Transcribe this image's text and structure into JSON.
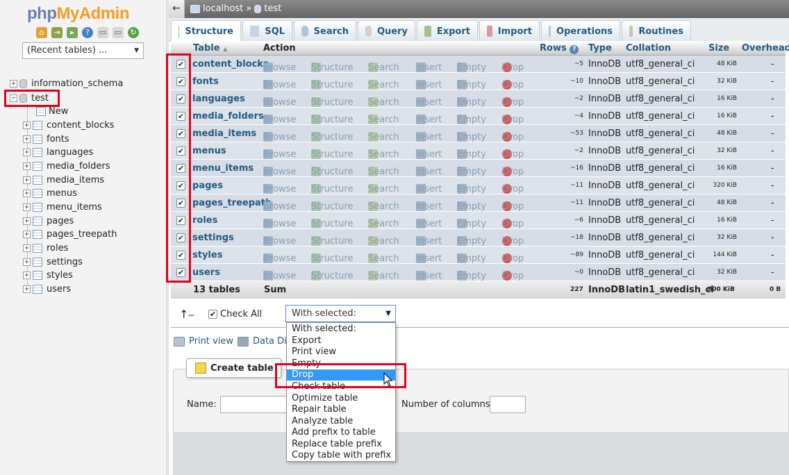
{
  "nav": {
    "logo_php": "php",
    "logo_myadmin": "MyAdmin",
    "recent_tables": "(Recent tables) ...",
    "databases": [
      {
        "name": "information_schema"
      },
      {
        "name": "test"
      }
    ],
    "new_label": "New",
    "tables": [
      "content_blocks",
      "fonts",
      "languages",
      "media_folders",
      "media_items",
      "menus",
      "menu_items",
      "pages",
      "pages_treepath",
      "roles",
      "settings",
      "styles",
      "users"
    ]
  },
  "topbar": {
    "back": "←",
    "server": "localhost",
    "sep": "»",
    "database": "test"
  },
  "tabs": [
    {
      "label": "Structure",
      "active": true
    },
    {
      "label": "SQL"
    },
    {
      "label": "Search"
    },
    {
      "label": "Query"
    },
    {
      "label": "Export"
    },
    {
      "label": "Import"
    },
    {
      "label": "Operations"
    },
    {
      "label": "Routines"
    }
  ],
  "table_headers": {
    "table": "Table",
    "sort_arrow": "▲",
    "action": "Action",
    "rows": "Rows",
    "type": "Type",
    "collation": "Collation",
    "size": "Size",
    "overhead": "Overhead"
  },
  "actions": {
    "browse": "Browse",
    "structure": "Structure",
    "search": "Search",
    "insert": "Insert",
    "empty": "Empty",
    "drop": "Drop"
  },
  "rows": [
    {
      "name": "content_blocks",
      "rows": "~5",
      "type": "InnoDB",
      "collation": "utf8_general_ci",
      "size": "48 KiB",
      "overhead": "-"
    },
    {
      "name": "fonts",
      "rows": "~10",
      "type": "InnoDB",
      "collation": "utf8_general_ci",
      "size": "32 KiB",
      "overhead": "-"
    },
    {
      "name": "languages",
      "rows": "~2",
      "type": "InnoDB",
      "collation": "utf8_general_ci",
      "size": "16 KiB",
      "overhead": "-"
    },
    {
      "name": "media_folders",
      "rows": "~4",
      "type": "InnoDB",
      "collation": "utf8_general_ci",
      "size": "16 KiB",
      "overhead": "-"
    },
    {
      "name": "media_items",
      "rows": "~53",
      "type": "InnoDB",
      "collation": "utf8_general_ci",
      "size": "48 KiB",
      "overhead": "-"
    },
    {
      "name": "menus",
      "rows": "~2",
      "type": "InnoDB",
      "collation": "utf8_general_ci",
      "size": "32 KiB",
      "overhead": "-"
    },
    {
      "name": "menu_items",
      "rows": "~16",
      "type": "InnoDB",
      "collation": "utf8_general_ci",
      "size": "16 KiB",
      "overhead": "-"
    },
    {
      "name": "pages",
      "rows": "~11",
      "type": "InnoDB",
      "collation": "utf8_general_ci",
      "size": "320 KiB",
      "overhead": "-"
    },
    {
      "name": "pages_treepath",
      "rows": "~11",
      "type": "InnoDB",
      "collation": "utf8_general_ci",
      "size": "48 KiB",
      "overhead": "-"
    },
    {
      "name": "roles",
      "rows": "~6",
      "type": "InnoDB",
      "collation": "utf8_general_ci",
      "size": "16 KiB",
      "overhead": "-"
    },
    {
      "name": "settings",
      "rows": "~18",
      "type": "InnoDB",
      "collation": "utf8_general_ci",
      "size": "32 KiB",
      "overhead": "-"
    },
    {
      "name": "styles",
      "rows": "~89",
      "type": "InnoDB",
      "collation": "utf8_general_ci",
      "size": "144 KiB",
      "overhead": "-"
    },
    {
      "name": "users",
      "rows": "~0",
      "type": "InnoDB",
      "collation": "utf8_general_ci",
      "size": "32 KiB",
      "overhead": "-"
    }
  ],
  "summary": {
    "count": "13 tables",
    "label": "Sum",
    "rows": "227",
    "type": "InnoDB",
    "collation": "latin1_swedish_ci",
    "size": "800 KiB",
    "overhead": "0 B"
  },
  "bulk": {
    "check_all": "Check All",
    "with_selected": "With selected:"
  },
  "dropdown_options": [
    "With selected:",
    "Export",
    "Print view",
    "Empty",
    "Drop",
    "Check table",
    "Optimize table",
    "Repair table",
    "Analyze table",
    "Add prefix to table",
    "Replace table prefix",
    "Copy table with prefix"
  ],
  "dropdown_selected": "Drop",
  "links": {
    "print_view": "Print view",
    "data_dict": "Data Dict"
  },
  "create_table": {
    "legend": "Create table",
    "name_label": "Name:",
    "cols_label": "Number of columns:"
  }
}
